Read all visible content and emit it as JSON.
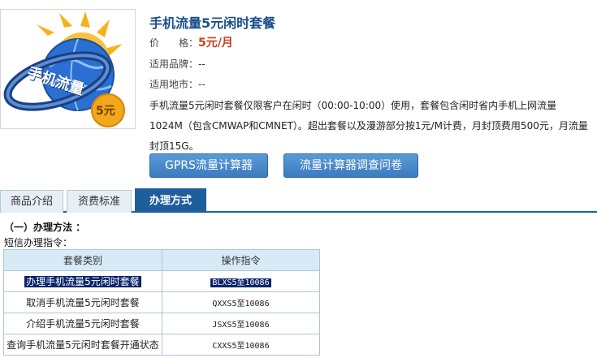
{
  "product": {
    "image_badge": "5元",
    "image_text": "手机流量",
    "title": "手机流量5元闲时套餐",
    "price_label": "价　　格：",
    "price_value": "5元/月",
    "brand_label": "适用品牌：",
    "brand_value": "--",
    "region_label": "适用地市：",
    "region_value": "--",
    "description": "手机流量5元闲时套餐仅限客户在闲时（00:00-10:00）使用，套餐包含闲时省内手机上网流量1024M（包含CMWAP和CMNET）。超出套餐以及漫游部分按1元/M计费，月封顶费用500元，月流量封顶15G。"
  },
  "buttons": {
    "gprs_calc": "GPRS流量计算器",
    "survey": "流量计算器调查问卷"
  },
  "tabs": [
    {
      "label": "商品介绍",
      "active": false
    },
    {
      "label": "资费标准",
      "active": false
    },
    {
      "label": "办理方式",
      "active": true
    }
  ],
  "section": {
    "title": "（一）办理方法 ：",
    "subtitle": "短信办理指令："
  },
  "table": {
    "headers": [
      "套餐类别",
      "操作指令"
    ],
    "rows": [
      {
        "category": "办理手机流量5元闲时套餐",
        "command": "BLXS5至10086",
        "selected": true
      },
      {
        "category": "取消手机流量5元闲时套餐",
        "command": "QXXS5至10086",
        "selected": false
      },
      {
        "category": "介绍手机流量5元闲时套餐",
        "command": "JSXS5至10086",
        "selected": false
      },
      {
        "category": "查询手机流量5元闲时套餐开通状态",
        "command": "CXXS5至10086",
        "selected": false
      }
    ]
  },
  "colors": {
    "accent": "#1f5e9d",
    "price": "#c8401c",
    "button": "#3b7bbf",
    "table_header": "#d7eaf6"
  }
}
